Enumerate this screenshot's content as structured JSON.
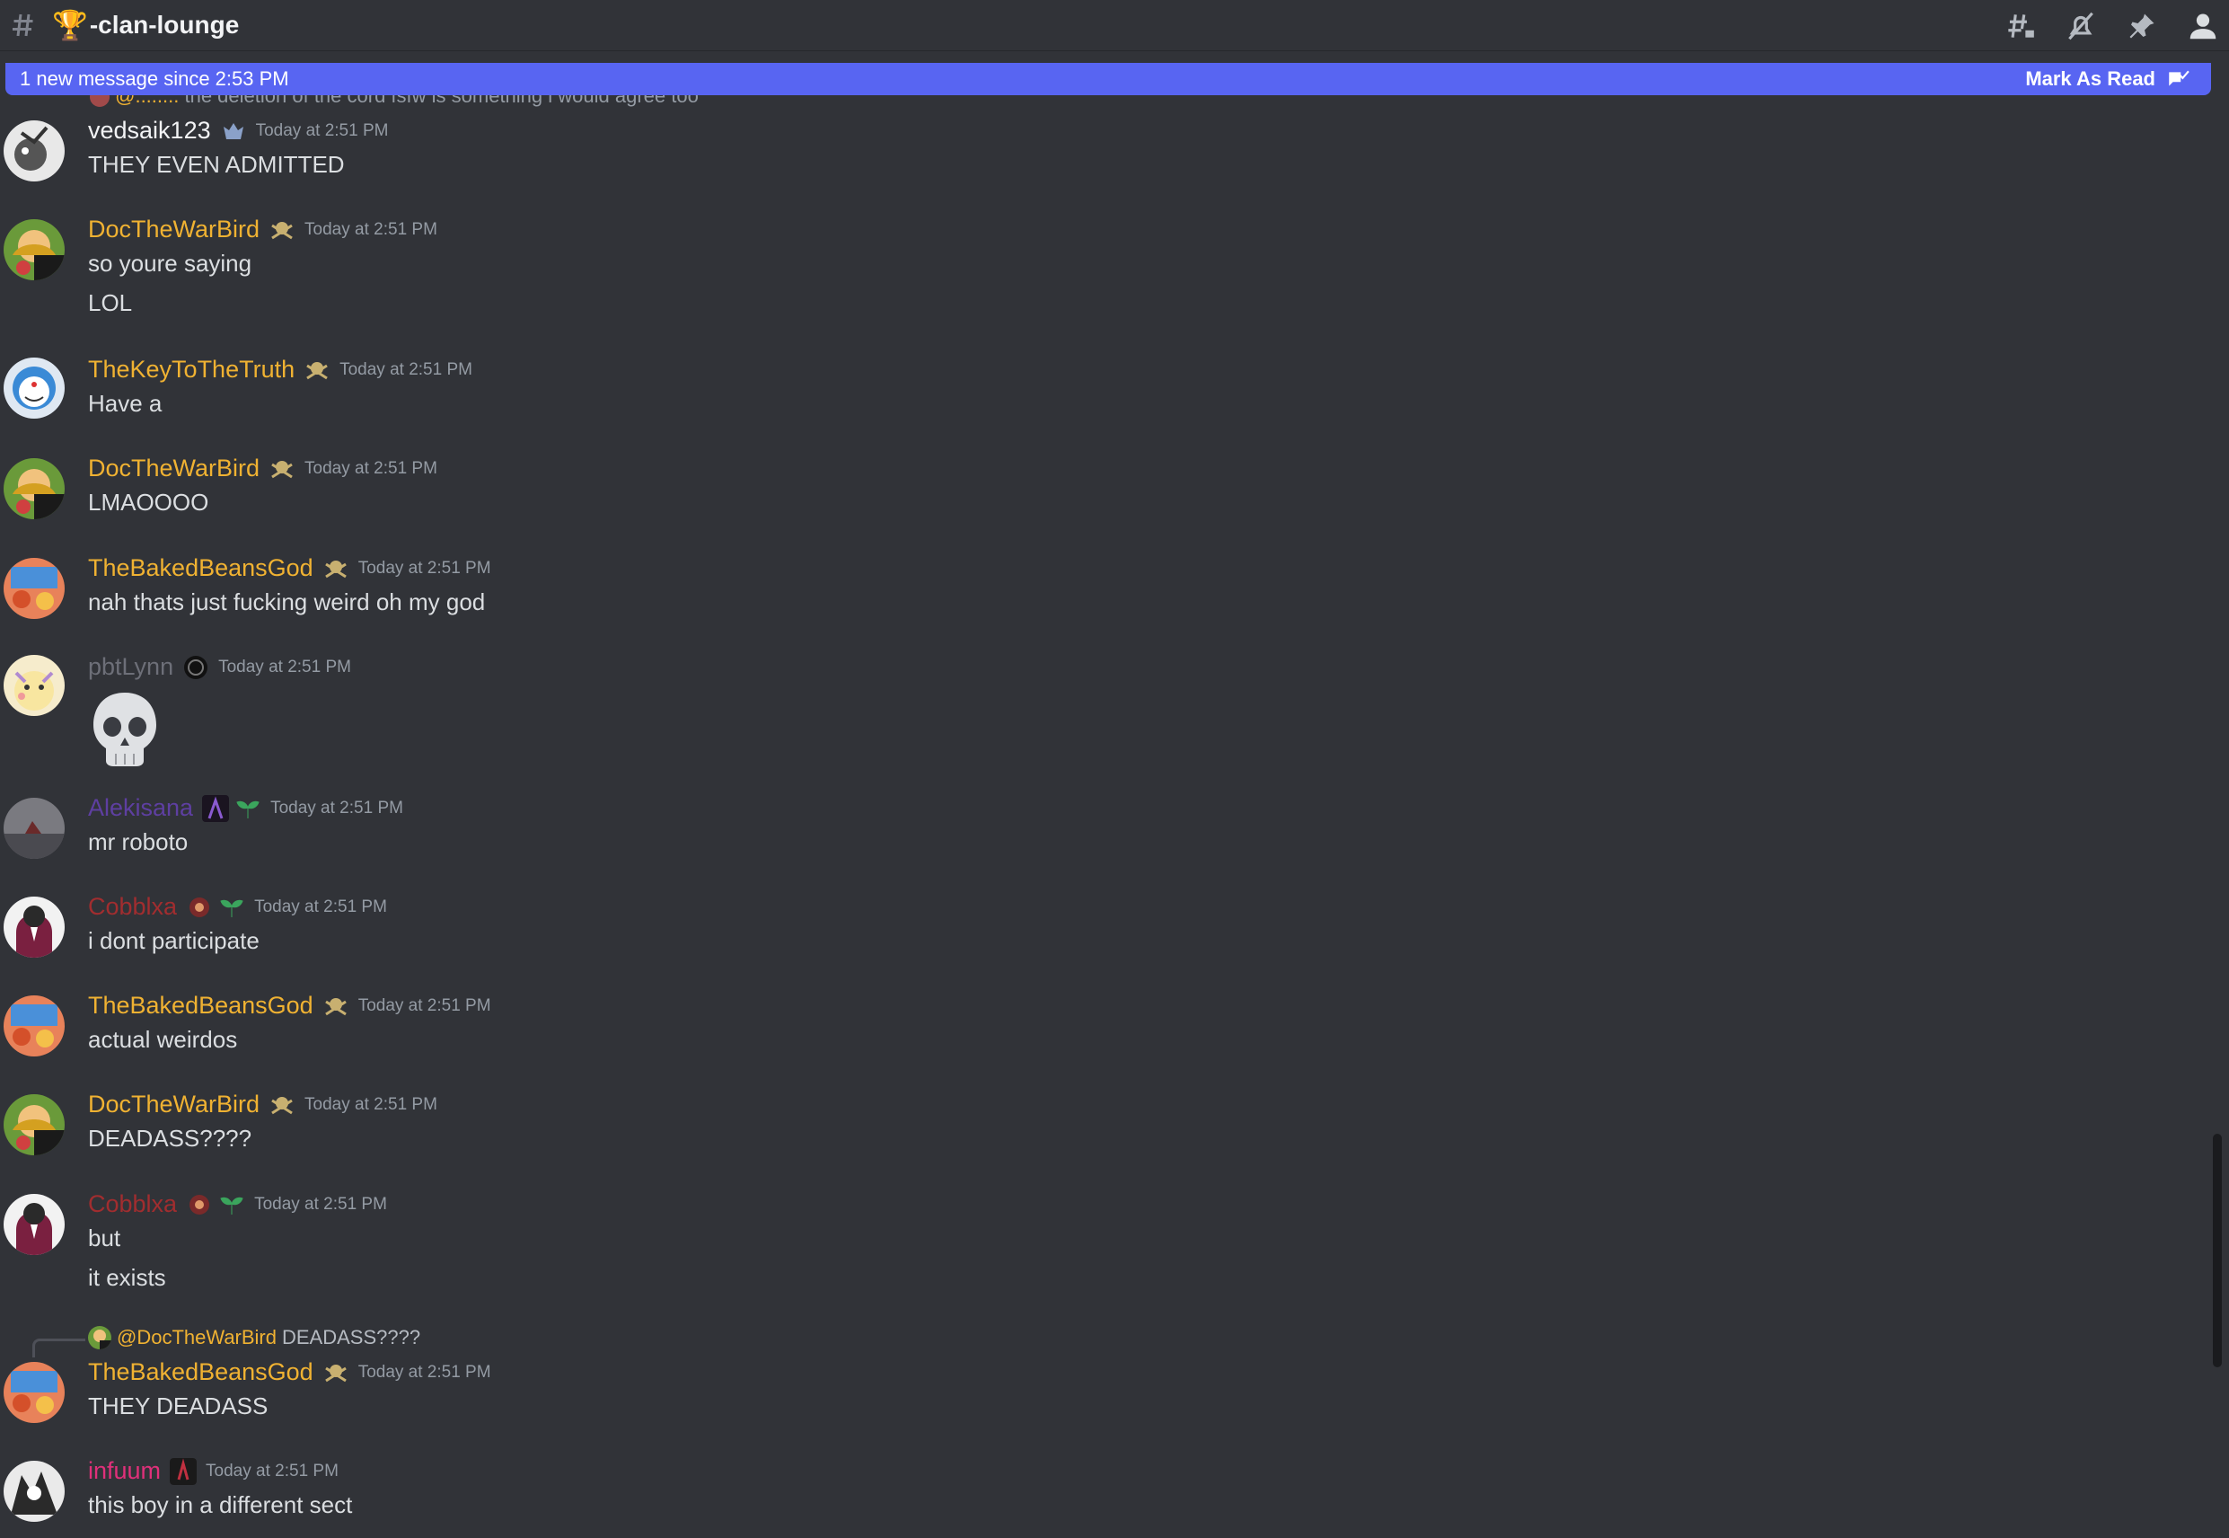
{
  "channel": {
    "emoji": "🏆",
    "name": "-clan-lounge"
  },
  "toolbar_icons": [
    "threads-icon",
    "mute-icon",
    "pin-icon",
    "member-list-icon"
  ],
  "banner": {
    "text": "1 new message since 2:53 PM",
    "mark_read": "Mark As Read"
  },
  "top_reply_fragment": "the deletion of the cord fsfw is something i would agree too",
  "colors": {
    "gold": "#f0b232",
    "white_name": "#f2f3f5",
    "gray_name": "#6d6f78",
    "purple_name": "#5e3fa1",
    "red_name": "#a12d2f",
    "pink_name": "#e0307a",
    "banner": "#5865f2"
  },
  "messages": [
    {
      "user": "vedsaik123",
      "time": "Today at 2:51 PM",
      "lines": [
        "THEY EVEN ADMITTED"
      ]
    },
    {
      "user": "DocTheWarBird",
      "time": "Today at 2:51 PM",
      "lines": [
        "so youre saying",
        "LOL"
      ]
    },
    {
      "user": "TheKeyToTheTruth",
      "time": "Today at 2:51 PM",
      "lines": [
        "Have a"
      ]
    },
    {
      "user": "DocTheWarBird",
      "time": "Today at 2:51 PM",
      "lines": [
        "LMAOOOO"
      ]
    },
    {
      "user": "TheBakedBeansGod",
      "time": "Today at 2:51 PM",
      "lines": [
        "nah thats just fucking weird oh my god"
      ]
    },
    {
      "user": "pbtLynn",
      "time": "Today at 2:51 PM",
      "lines": []
    },
    {
      "user": "Alekisana",
      "time": "Today at 2:51 PM",
      "lines": [
        "mr roboto"
      ]
    },
    {
      "user": "Cobblxa",
      "time": "Today at 2:51 PM",
      "lines": [
        "i dont participate"
      ]
    },
    {
      "user": "TheBakedBeansGod",
      "time": "Today at 2:51 PM",
      "lines": [
        "actual weirdos"
      ]
    },
    {
      "user": "DocTheWarBird",
      "time": "Today at 2:51 PM",
      "lines": [
        "DEADASS????"
      ]
    },
    {
      "user": "Cobblxa",
      "time": "Today at 2:51 PM",
      "lines": [
        "but",
        "it exists"
      ]
    },
    {
      "user": "TheBakedBeansGod",
      "time": "Today at 2:51 PM",
      "lines": [
        "THEY DEADASS"
      ],
      "reply": {
        "mention": "@DocTheWarBird",
        "text": "DEADASS????"
      }
    },
    {
      "user": "infuum",
      "time": "Today at 2:51 PM",
      "lines": [
        "this boy in a different sect"
      ]
    }
  ]
}
